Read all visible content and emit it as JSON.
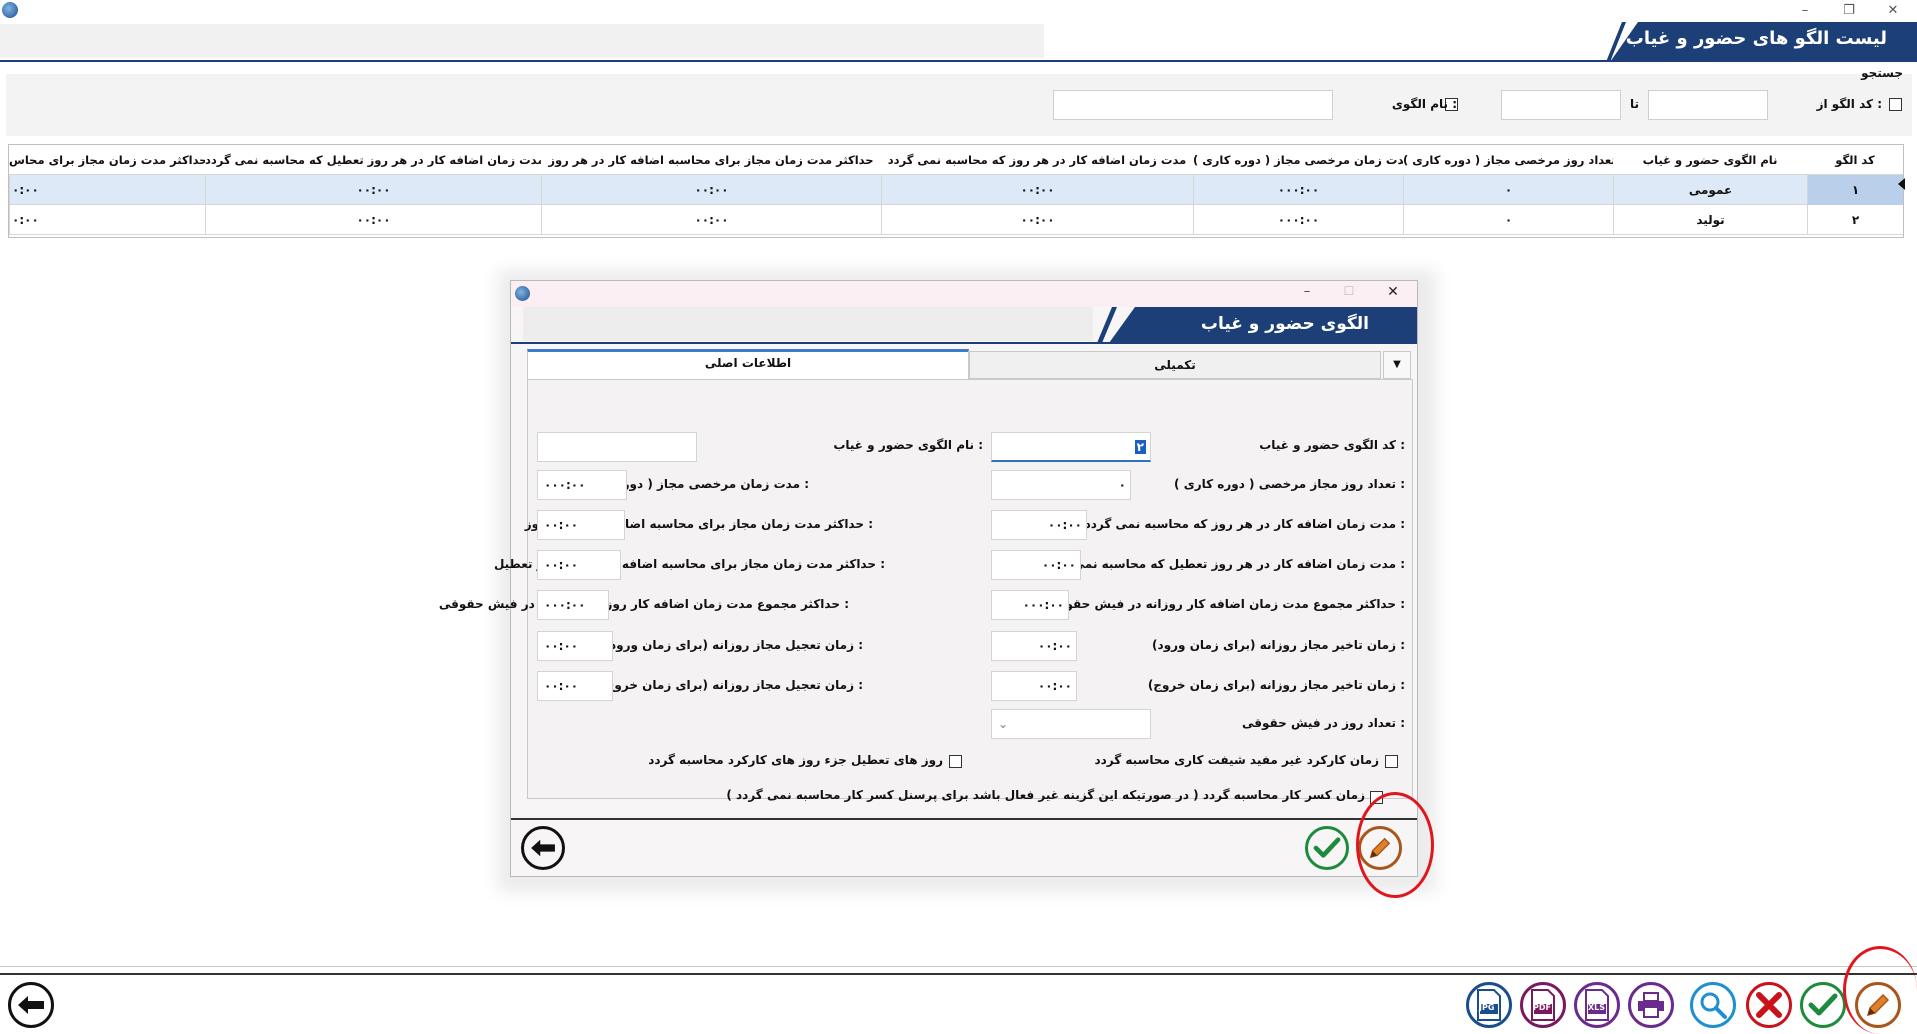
{
  "main": {
    "title": "لیست الگو های حضور و غیاب",
    "search_label": "جستجو",
    "search": {
      "code_from_label": "کد الگو از :",
      "to_label": "تا",
      "name_label": "نام الگوی :"
    },
    "table": {
      "headers": [
        "کد الگو",
        "نام الگوی حضور و غیاب",
        "تعداد روز مرخصی مجاز ( دوره کاری )",
        "مدت زمان مرخصی مجاز ( دوره کاری )",
        "مدت زمان اضافه کار در هر روز که محاسبه نمی گردد",
        "حداکثر مدت زمان مجاز برای محاسبه اضافه کار در هر روز",
        "مدت زمان اضافه کار در هر روز تعطیل که محاسبه نمی گردد",
        "حداکثر مدت زمان مجاز برای محاس"
      ],
      "rows": [
        [
          "۱",
          "عمومی",
          "۰",
          "۰۰۰:۰۰",
          "۰۰:۰۰",
          "۰۰:۰۰",
          "۰۰:۰۰",
          "۰:۰۰"
        ],
        [
          "۲",
          "تولید",
          "۰",
          "۰۰۰:۰۰",
          "۰۰:۰۰",
          "۰۰:۰۰",
          "۰۰:۰۰",
          "۰:۰۰"
        ]
      ]
    }
  },
  "dialog": {
    "title": "الگوی حضور و غیاب",
    "tabs": [
      "اطلاعات اصلی",
      "تکمیلی"
    ],
    "fields": {
      "code_label": "کد الگوی حضور و غیاب :",
      "code_value": "۲",
      "name_label": "نام الگوی حضور و غیاب :",
      "leave_days_label": "تعداد روز مجاز مرخصی  ( دوره کاری ) :",
      "leave_days_value": "۰",
      "leave_time_label": "مدت زمان مرخصی مجاز ( دوره کاری ) :",
      "leave_time_value": "۰۰۰:۰۰",
      "ot_daily_ignored_label": "مدت زمان اضافه کار در هر روز که محاسبه نمی گردد :",
      "ot_daily_ignored_value": "۰۰:۰۰",
      "ot_daily_max_label": "حداکثر مدت زمان مجاز برای محاسبه اضافه کار در هر روز :",
      "ot_daily_max_value": "۰۰:۰۰",
      "ot_holiday_ignored_label": "مدت زمان اضافه کار در هر روز تعطیل که محاسبه نمی گردد :",
      "ot_holiday_ignored_value": "۰۰:۰۰",
      "ot_holiday_max_label": "حداکثر مدت زمان مجاز برای محاسبه اضافه کار در هر روز  تعطیل :",
      "ot_holiday_max_value": "۰۰:۰۰",
      "ot_total_payslip_label": "حداکثر مجموع مدت زمان اضافه کار روزانه در فیش حقوقی :",
      "ot_total_payslip_value": "۰۰۰:۰۰",
      "ot_total_holiday_payslip_label": "حداکثر مجموع مدت زمان اضافه کار روزهای تعطیل  در فیش حقوقی :",
      "ot_total_holiday_payslip_value": "۰۰۰:۰۰",
      "late_entry_label": "زمان تاخیر مجاز روزانه (برای زمان ورود) :",
      "late_entry_value": "۰۰:۰۰",
      "early_entry_label": "زمان تعجیل مجاز روزانه (برای زمان ورود) :",
      "early_entry_value": "۰۰:۰۰",
      "late_exit_label": "زمان تاخیر مجاز روزانه (برای زمان خروج) :",
      "late_exit_value": "۰۰:۰۰",
      "early_exit_label": "زمان تعجیل مجاز روزانه (برای زمان خروج) :",
      "early_exit_value": "۰۰:۰۰",
      "payslip_days_label": "تعداد روز در فیش حقوقی :",
      "non_useful_label": "زمان کارکرد غیر مفید شیفت کاری محاسبه گردد",
      "holidays_label": "روز های تعطیل جزء روز های کارکرد محاسبه گردد",
      "deduction_label": "زمان کسر کار محاسبه گردد ( در صورتیکه این گزینه غیر فعال باشد برای پرسنل کسر کار محاسبه نمی گردد )"
    }
  },
  "toolbar_icons": [
    "edit-icon",
    "confirm-icon",
    "delete-icon",
    "search-icon",
    "print-icon",
    "xls-icon",
    "pdf-icon",
    "jpg-icon",
    "back-arrow-icon"
  ],
  "toolbar_labels": {
    "xls": "XLS",
    "pdf": "PDF",
    "jpg": "JPG"
  },
  "colors": {
    "header_blue": "#1c3f78",
    "highlight_ring": "#e0161f",
    "selected_row": "#dde9f7"
  }
}
